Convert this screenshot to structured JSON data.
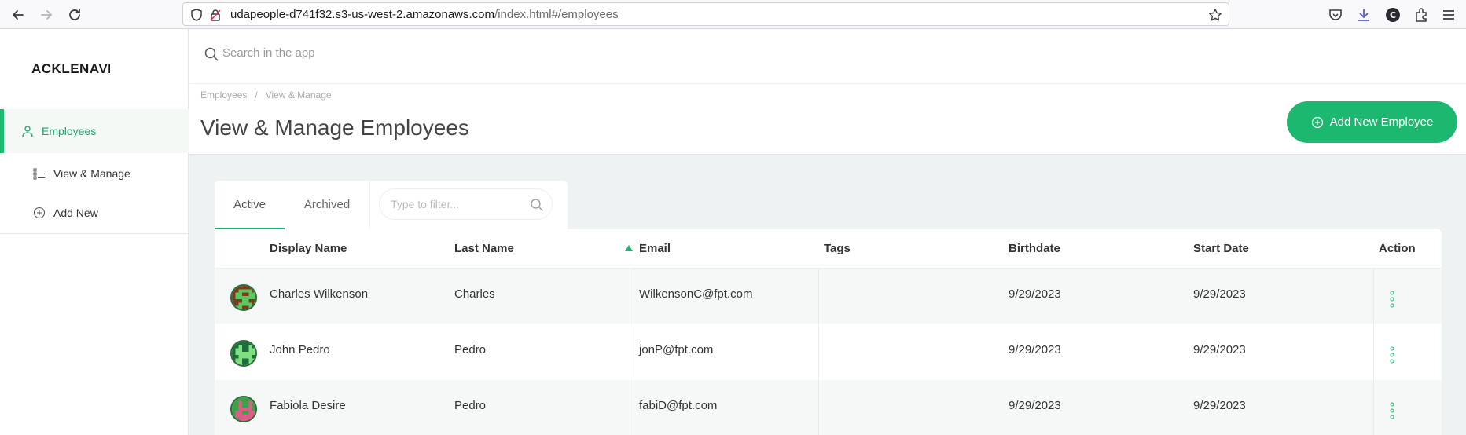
{
  "browser": {
    "url_host": "udapeople-d741f32.s3-us-west-2.amazonaws.com",
    "url_path": "/index.html#/employees"
  },
  "sidebar": {
    "logo": "ACKLENAVENUE",
    "items": [
      {
        "label": "Employees",
        "icon": "user-icon",
        "active": true
      },
      {
        "label": "View & Manage",
        "icon": "list-icon",
        "active": false
      },
      {
        "label": "Add New",
        "icon": "plus-circle-icon",
        "active": false
      }
    ]
  },
  "search": {
    "placeholder": "Search in the app"
  },
  "header": {
    "breadcrumb": [
      "Employees",
      "View & Manage"
    ],
    "title": "View & Manage Employees",
    "add_button": "Add New Employee"
  },
  "tabs": [
    "Active",
    "Archived"
  ],
  "filter": {
    "placeholder": "Type to filter..."
  },
  "table": {
    "columns": [
      "Display Name",
      "Last Name",
      "Email",
      "Tags",
      "Birthdate",
      "Start Date",
      "Action"
    ],
    "rows": [
      {
        "display_name": "Charles Wilkenson",
        "last_name": "Charles",
        "email": "WilkensonC@fpt.com",
        "tags": "",
        "birthdate": "9/29/2023",
        "start_date": "9/29/2023",
        "avatar_color": "#5cc860"
      },
      {
        "display_name": "John Pedro",
        "last_name": "Pedro",
        "email": "jonP@fpt.com",
        "tags": "",
        "birthdate": "9/29/2023",
        "start_date": "9/29/2023",
        "avatar_color": "#1e6b3c"
      },
      {
        "display_name": "Fabiola Desire",
        "last_name": "Pedro",
        "email": "fabiD@fpt.com",
        "tags": "",
        "birthdate": "9/29/2023",
        "start_date": "9/29/2023",
        "avatar_color": "#e05a8a"
      }
    ]
  },
  "colors": {
    "accent": "#1db86f",
    "content_bg": "#eef2f2"
  }
}
